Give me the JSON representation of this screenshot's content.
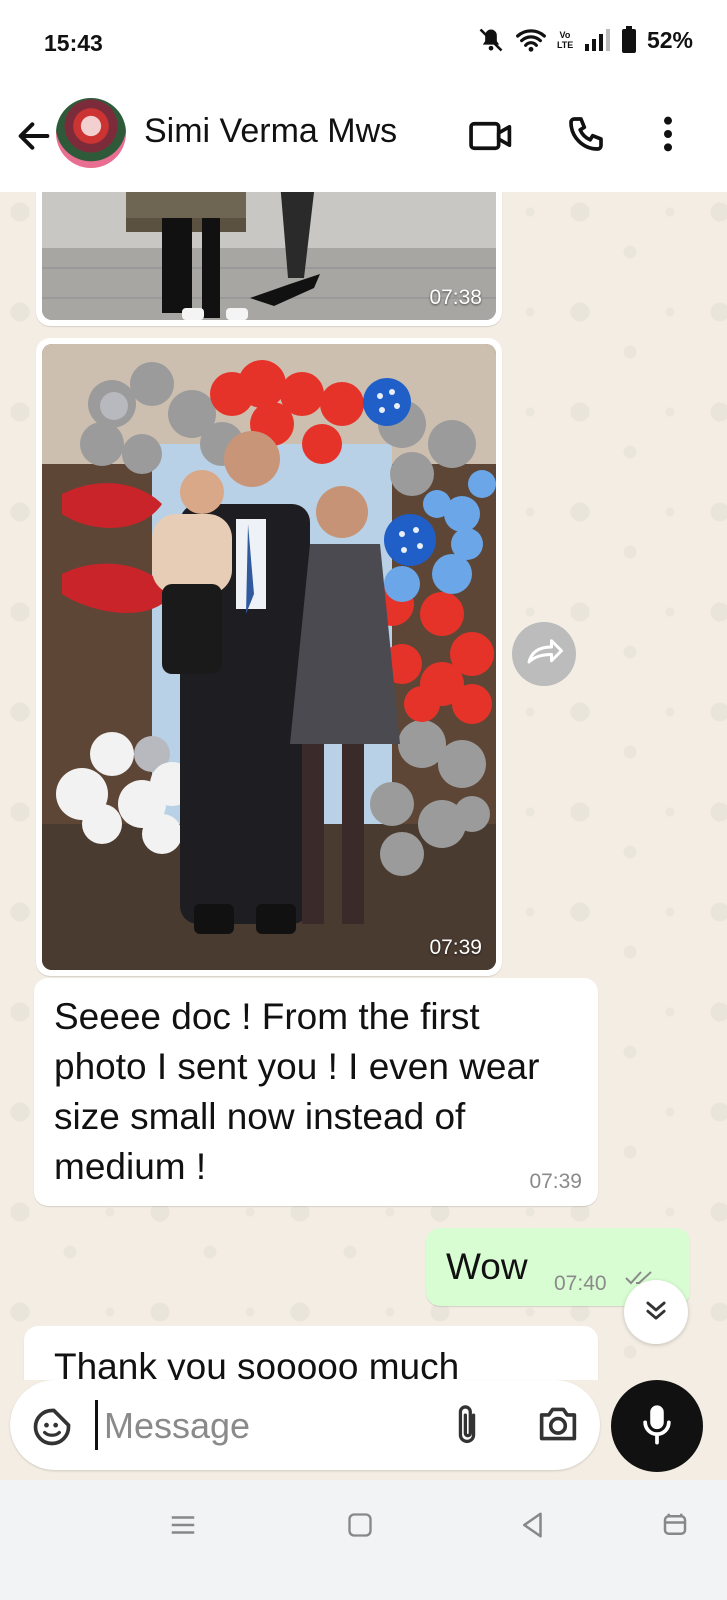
{
  "status_bar": {
    "time": "15:43",
    "battery": "52%",
    "network_label": "Vo LTE"
  },
  "header": {
    "contact_name": "Simi Verma Mws"
  },
  "messages": [
    {
      "type": "image",
      "time": "07:38"
    },
    {
      "type": "image",
      "time": "07:39"
    },
    {
      "type": "text",
      "direction": "in",
      "text": "Seeee doc ! From the first photo I sent you ! I even wear size small now instead of medium !",
      "time": "07:39"
    },
    {
      "type": "text",
      "direction": "out",
      "text": "Wow",
      "time": "07:40"
    },
    {
      "type": "text",
      "direction": "in",
      "text": "Thank you sooooo much"
    }
  ],
  "composer": {
    "placeholder": "Message"
  },
  "colors": {
    "incoming": "#ffffff",
    "outgoing": "#d9fdd3",
    "chat_background": "#f3ede3"
  }
}
